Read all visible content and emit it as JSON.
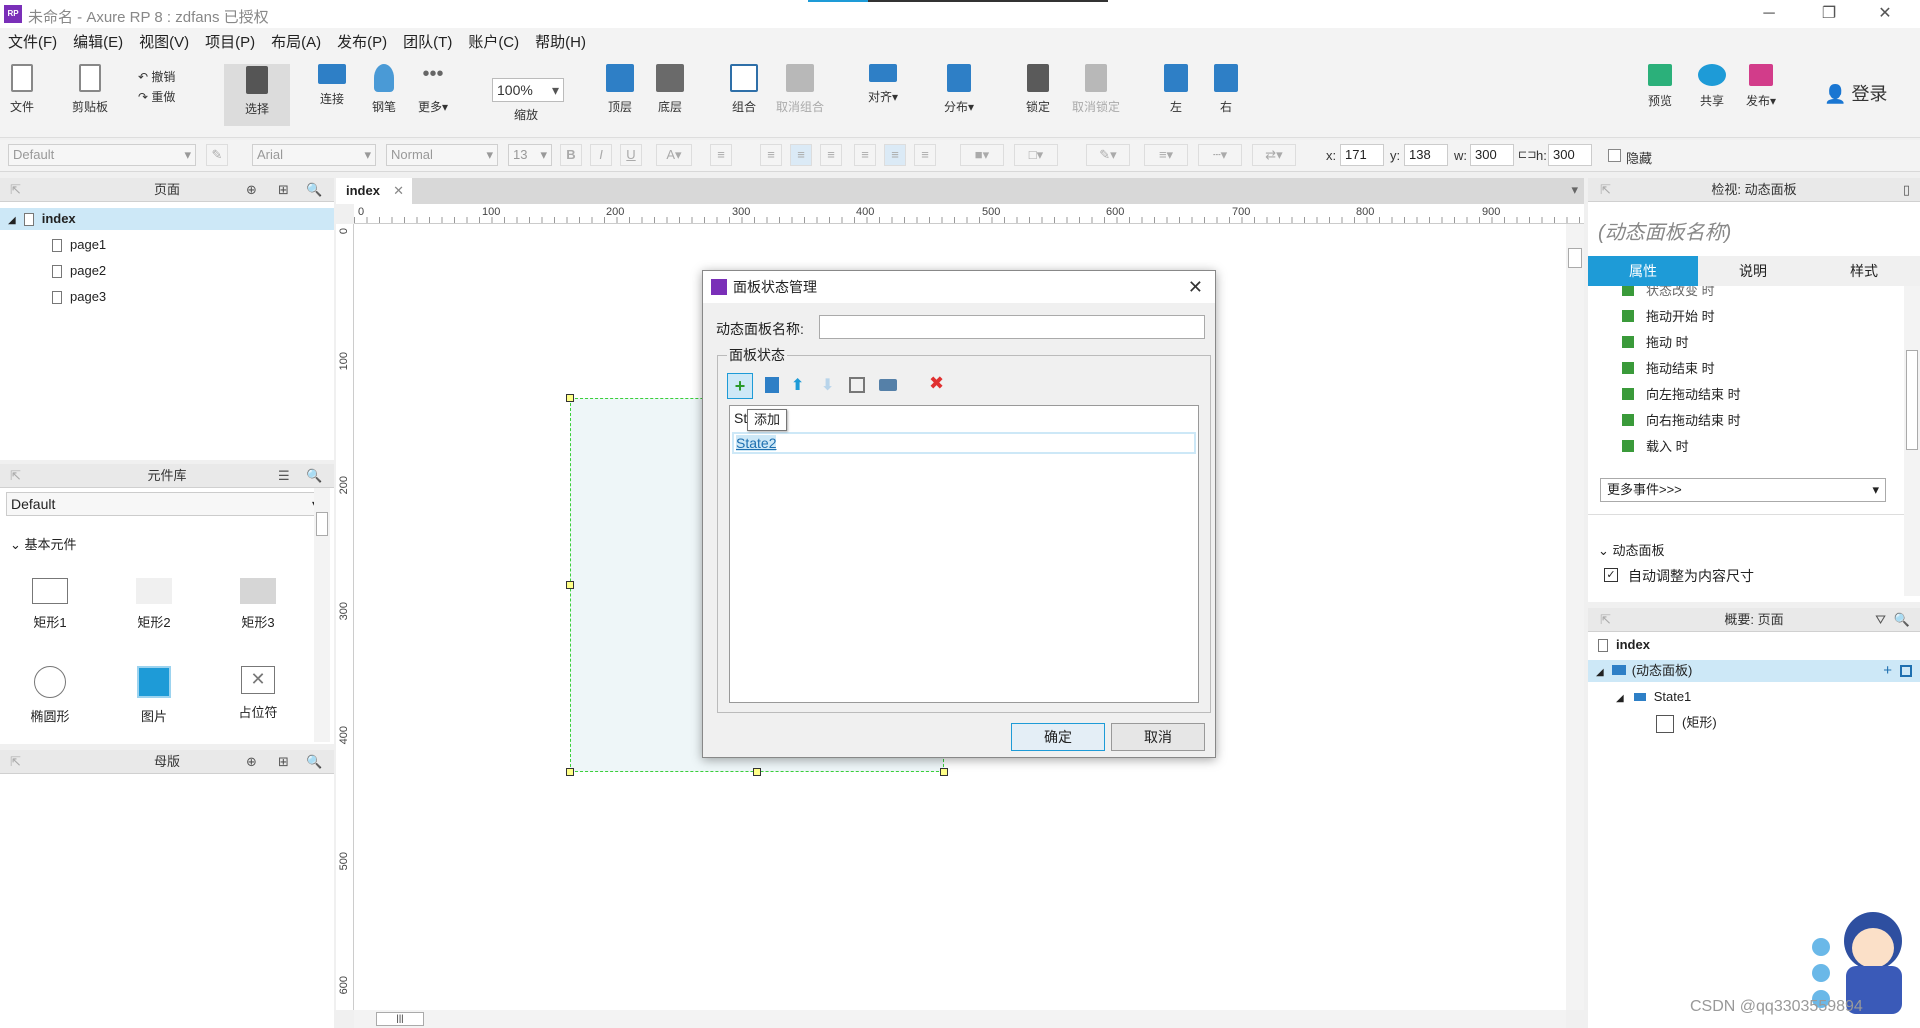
{
  "window": {
    "title": "未命名 - Axure RP 8 : zdfans 已授权",
    "logo": "RP",
    "controls": [
      "─",
      "❐",
      "✕"
    ]
  },
  "menu": [
    "文件(F)",
    "编辑(E)",
    "视图(V)",
    "项目(P)",
    "布局(A)",
    "发布(P)",
    "团队(T)",
    "账户(C)",
    "帮助(H)"
  ],
  "toolbar": {
    "file": "文件",
    "clipboard": "剪贴板",
    "undo": "撤销",
    "redo": "重做",
    "select": "选择",
    "connect": "连接",
    "pen": "钢笔",
    "more": "更多▾",
    "zoom_value": "100%",
    "zoom_label": "缩放",
    "top_layer": "顶层",
    "bottom_layer": "底层",
    "group": "组合",
    "ungroup": "取消组合",
    "align": "对齐▾",
    "distribute": "分布▾",
    "lock": "锁定",
    "unlock": "取消锁定",
    "left": "左",
    "right": "右",
    "preview": "预览",
    "share": "共享",
    "publish": "发布▾",
    "login": "登录"
  },
  "format": {
    "style": "Default",
    "font": "Arial",
    "weight": "Normal",
    "size": "13",
    "x_label": "x:",
    "x": "171",
    "y_label": "y:",
    "y": "138",
    "w_label": "w:",
    "w": "300",
    "h_label": "h:",
    "h": "300",
    "hide": "隐藏"
  },
  "pages_panel": {
    "title": "页面",
    "root": "index",
    "pages": [
      "page1",
      "page2",
      "page3"
    ]
  },
  "library_panel": {
    "title": "元件库",
    "selected_library": "Default",
    "section": "基本元件",
    "widgets": [
      "矩形1",
      "矩形2",
      "矩形3",
      "椭圆形",
      "图片",
      "占位符"
    ]
  },
  "masters_panel": {
    "title": "母版"
  },
  "canvas": {
    "tab": "index",
    "ruler_h": [
      "0",
      "100",
      "200",
      "300",
      "400",
      "500",
      "600",
      "700",
      "800",
      "900"
    ],
    "ruler_v": [
      "0",
      "100",
      "200",
      "300",
      "400",
      "500",
      "600"
    ]
  },
  "dialog": {
    "title": "面板状态管理",
    "name_label": "动态面板名称:",
    "name_value": "",
    "group_label": "面板状态",
    "states": [
      "State1",
      "State2"
    ],
    "tooltip": "添加",
    "ok": "确定",
    "cancel": "取消"
  },
  "inspector": {
    "title": "检视: 动态面板",
    "name_placeholder": "(动态面板名称)",
    "tabs": [
      "属性",
      "说明",
      "样式"
    ],
    "events": [
      "状态改变 时",
      "拖动开始 时",
      "拖动 时",
      "拖动结束 时",
      "向左拖动结束 时",
      "向右拖动结束 时",
      "载入 时"
    ],
    "more_events": "更多事件>>>",
    "section": "动态面板",
    "auto_fit": "自动调整为内容尺寸"
  },
  "outline": {
    "title": "概要: 页面",
    "root": "index",
    "items": [
      "(动态面板)",
      "State1",
      "(矩形)"
    ]
  },
  "watermark": "CSDN @qq3303559894",
  "colors": {
    "accent": "#1e9bd7",
    "selection": "#cde8f7",
    "dashed_border": "#3ad03a",
    "delete_red": "#e03030"
  }
}
